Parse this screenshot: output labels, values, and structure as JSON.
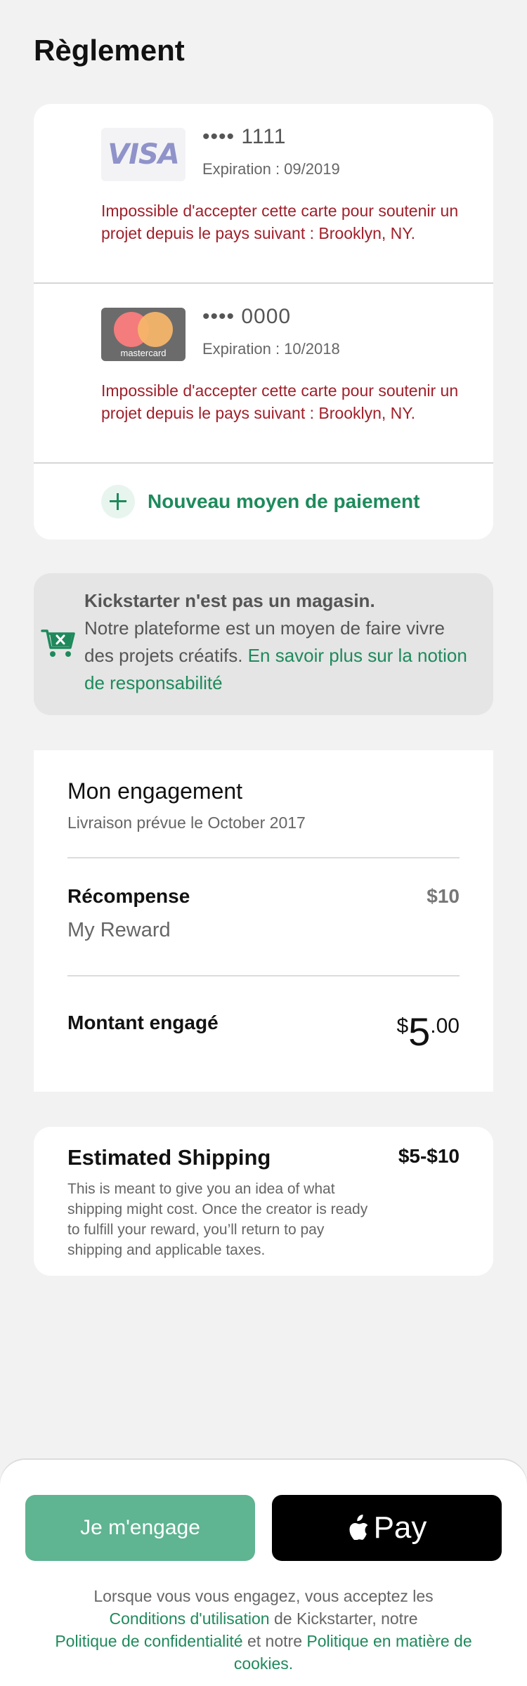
{
  "page": {
    "title": "Règlement"
  },
  "payment_methods": {
    "cards": [
      {
        "brand": "VISA",
        "number": "•••• 1111",
        "expiration": "Expiration : 09/2019",
        "error": "Impossible d'accepter cette carte pour soutenir un projet depuis le pays suivant : Brooklyn, NY."
      },
      {
        "brand": "mastercard",
        "number": "•••• 0000",
        "expiration": "Expiration : 10/2018",
        "error": "Impossible d'accepter cette carte pour soutenir un projet depuis le pays suivant : Brooklyn, NY."
      }
    ],
    "new_label": "Nouveau moyen de paiement"
  },
  "notice": {
    "title": "Kickstarter n'est pas un magasin.",
    "body": "Notre plateforme est un moyen de faire vivre des projets créatifs.",
    "link": "En savoir plus sur la notion de responsabilité"
  },
  "pledge": {
    "title": "Mon engagement",
    "delivery": "Livraison prévue le October 2017",
    "reward_label": "Récompense",
    "reward_price": "$10",
    "reward_name": "My Reward",
    "amount_label": "Montant engagé",
    "amount": {
      "currency": "$",
      "whole": "5",
      "cents": ".00"
    }
  },
  "shipping": {
    "title": "Estimated Shipping",
    "price": "$5-$10",
    "description": "This is meant to give you an idea of what shipping might cost. Once the creator is ready to fulfill your reward, you’ll return to pay shipping and applicable taxes."
  },
  "footer": {
    "pledge_button": "Je m'engage",
    "applepay_label": "Pay",
    "legal": {
      "t1": "Lorsque vous vous engagez, vous acceptez les",
      "l1": "Conditions d'utilisation",
      "t2": "de Kickstarter, notre",
      "l2": "Politique de confidentialité",
      "t3": "et notre",
      "l3": "Politique en matière de cookies."
    }
  },
  "colors": {
    "accent": "#1e8a5c",
    "error": "#a11f2a",
    "pledge_button": "#5fb492",
    "background": "#f2f2f2"
  }
}
